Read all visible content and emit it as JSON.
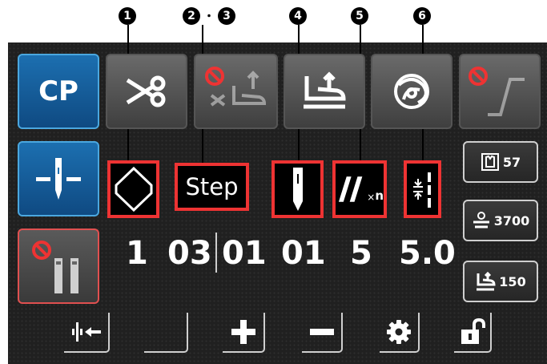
{
  "callouts": {
    "c1": "1",
    "c2": "2",
    "c2_sep": "・",
    "c3": "3",
    "c4": "4",
    "c5": "5",
    "c6": "6"
  },
  "top_row": {
    "cp_label": "CP",
    "buttons": [
      "cp",
      "thread-trim",
      "trim-presser-disabled",
      "presser-foot-lift",
      "tension-wheel",
      "curve-disabled"
    ]
  },
  "icon_boxes": {
    "step_label": "Step",
    "needle_count_label": "n"
  },
  "values": {
    "pattern": "1",
    "step_a": "03",
    "step_b": "01",
    "needle": "01",
    "repeat": "5",
    "pitch": "5.0"
  },
  "side_panel": {
    "counter": "57",
    "speed": "3700",
    "presser_height": "150"
  },
  "colors": {
    "accent_blue": "#4aa7df",
    "alert_red": "#e33333",
    "screen_bg": "#202020"
  }
}
